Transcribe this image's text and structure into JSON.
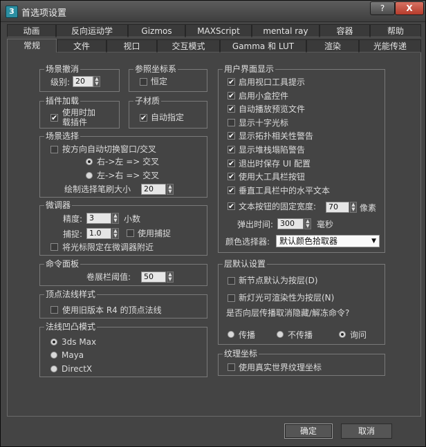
{
  "window": {
    "title": "首选项设置",
    "help": "?",
    "close": "X",
    "app_icon": "3"
  },
  "tabs_row1": [
    "动画",
    "反向运动学",
    "Gizmos",
    "MAXScript",
    "mental ray",
    "容器",
    "帮助"
  ],
  "tabs_row2": [
    "常规",
    "文件",
    "视口",
    "交互模式",
    "Gamma 和 LUT",
    "渲染",
    "光能传递"
  ],
  "scene_undo": {
    "title": "场景撤消",
    "level_label": "级别:",
    "level_value": "20"
  },
  "ref_coord": {
    "title": "参照坐标系",
    "constant_label": "恒定",
    "constant_checked": false
  },
  "plugin_load": {
    "title": "插件加载",
    "load_on_use_label_1": "使用时加",
    "load_on_use_label_2": "载插件",
    "load_on_use_checked": true
  },
  "sub_material": {
    "title": "子材质",
    "auto_assign_label": "自动指定",
    "auto_assign_checked": true
  },
  "scene_selection": {
    "title": "场景选择",
    "auto_window_label": "按方向自动切换窗口/交叉",
    "auto_window_checked": false,
    "opt_rtl": "右->左 => 交叉",
    "opt_ltr": "左->右 => 交叉",
    "selected": "rtl",
    "brush_size_label": "绘制选择笔刷大小",
    "brush_size_value": "20"
  },
  "spinners": {
    "title": "微调器",
    "precision_label": "精度:",
    "precision_value": "3",
    "decimals_label": "小数",
    "snap_label": "捕捉:",
    "snap_value": "1.0",
    "use_snap_label": "使用捕捉",
    "use_snap_checked": false,
    "wrap_cursor_label": "将光标限定在微调器附近",
    "wrap_cursor_checked": false
  },
  "command_panel": {
    "title": "命令面板",
    "rollup_label": "卷展栏阈值:",
    "rollup_value": "50"
  },
  "vertex_normals": {
    "title": "顶点法线样式",
    "legacy_label": "使用旧版本 R4 的顶点法线",
    "legacy_checked": false
  },
  "bump_mode": {
    "title": "法线凹凸模式",
    "options": [
      "3ds Max",
      "Maya",
      "DirectX"
    ],
    "selected": "3ds Max"
  },
  "ui_display": {
    "title": "用户界面显示",
    "items": [
      {
        "label": "启用视口工具提示",
        "checked": true
      },
      {
        "label": "启用小盒控件",
        "checked": true
      },
      {
        "label": "自动播放预览文件",
        "checked": true
      },
      {
        "label": "显示十字光标",
        "checked": false
      },
      {
        "label": "显示拓扑相关性警告",
        "checked": true
      },
      {
        "label": "显示堆栈塌陷警告",
        "checked": true
      },
      {
        "label": "退出时保存 UI 配置",
        "checked": true
      },
      {
        "label": "使用大工具栏按钮",
        "checked": true
      },
      {
        "label": "垂直工具栏中的水平文本",
        "checked": true
      }
    ],
    "fixed_width_label": "文本按钮的固定宽度:",
    "fixed_width_checked": true,
    "fixed_width_value": "70",
    "fixed_width_unit": "像素",
    "flyout_label": "弹出时间:",
    "flyout_value": "300",
    "flyout_unit": "毫秒",
    "color_picker_label": "颜色选择器:",
    "color_picker_value": "默认颜色拾取器"
  },
  "layer_defaults": {
    "title": "层默认设置",
    "new_node_label": "新节点默认为按层(D)",
    "new_node_checked": false,
    "new_light_label": "新灯光可渲染性为按层(N)",
    "new_light_checked": false,
    "propagate_question": "是否向层传播取消隐藏/解冻命令?",
    "opt_propagate": "传播",
    "opt_no_propagate": "不传播",
    "opt_ask": "询问",
    "selected": "ask"
  },
  "texture_coords": {
    "title": "纹理坐标",
    "real_world_label": "使用真实世界纹理坐标",
    "real_world_checked": false
  },
  "buttons": {
    "ok": "确定",
    "cancel": "取消"
  },
  "icons": {
    "checkmark": "✔",
    "spinner_up": "▲",
    "spinner_down": "▼",
    "dropdown_arrow": "▼"
  }
}
